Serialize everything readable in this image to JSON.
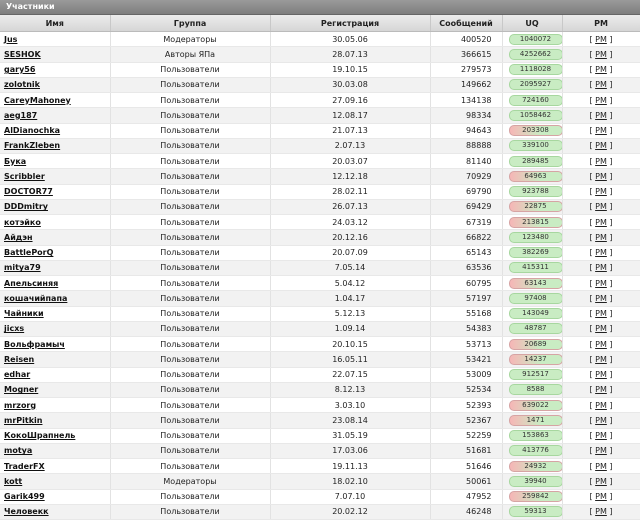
{
  "title": "Участники",
  "columns": {
    "name": "Имя",
    "group": "Группа",
    "reg": "Регистрация",
    "msgs": "Сообщений",
    "uq": "UQ",
    "pm": "PM"
  },
  "pm_label": "PM",
  "rows": [
    {
      "name": "Jus",
      "group": "Модераторы",
      "reg": "30.05.06",
      "msgs": "400520",
      "uq": "1040072",
      "sign": "pos"
    },
    {
      "name": "SESHOK",
      "group": "Авторы ЯПа",
      "reg": "28.07.13",
      "msgs": "366615",
      "uq": "4252662",
      "sign": "pos"
    },
    {
      "name": "gary56",
      "group": "Пользователи",
      "reg": "19.10.15",
      "msgs": "279573",
      "uq": "1118028",
      "sign": "pos"
    },
    {
      "name": "zolotnik",
      "group": "Пользователи",
      "reg": "30.03.08",
      "msgs": "149662",
      "uq": "2095927",
      "sign": "pos"
    },
    {
      "name": "CareyMahoney",
      "group": "Пользователи",
      "reg": "27.09.16",
      "msgs": "134138",
      "uq": "724160",
      "sign": "pos"
    },
    {
      "name": "aeg187",
      "group": "Пользователи",
      "reg": "12.08.17",
      "msgs": "98334",
      "uq": "1058462",
      "sign": "pos"
    },
    {
      "name": "AlDianochka",
      "group": "Пользователи",
      "reg": "21.07.13",
      "msgs": "94643",
      "uq": "203308",
      "sign": "neg"
    },
    {
      "name": "FrankZleben",
      "group": "Пользователи",
      "reg": "2.07.13",
      "msgs": "88888",
      "uq": "339100",
      "sign": "pos"
    },
    {
      "name": "Бука",
      "group": "Пользователи",
      "reg": "20.03.07",
      "msgs": "81140",
      "uq": "289485",
      "sign": "pos"
    },
    {
      "name": "Scribbler",
      "group": "Пользователи",
      "reg": "12.12.18",
      "msgs": "70929",
      "uq": "64963",
      "sign": "neg"
    },
    {
      "name": "DOCTOR77",
      "group": "Пользователи",
      "reg": "28.02.11",
      "msgs": "69790",
      "uq": "923788",
      "sign": "pos"
    },
    {
      "name": "DDDmitry",
      "group": "Пользователи",
      "reg": "26.07.13",
      "msgs": "69429",
      "uq": "22875",
      "sign": "neg"
    },
    {
      "name": "котэйко",
      "group": "Пользователи",
      "reg": "24.03.12",
      "msgs": "67319",
      "uq": "213815",
      "sign": "neg"
    },
    {
      "name": "Айдэн",
      "group": "Пользователи",
      "reg": "20.12.16",
      "msgs": "66822",
      "uq": "123480",
      "sign": "pos"
    },
    {
      "name": "BattlePorQ",
      "group": "Пользователи",
      "reg": "20.07.09",
      "msgs": "65143",
      "uq": "382269",
      "sign": "pos"
    },
    {
      "name": "mitya79",
      "group": "Пользователи",
      "reg": "7.05.14",
      "msgs": "63536",
      "uq": "415311",
      "sign": "pos"
    },
    {
      "name": "Апельсиняя",
      "group": "Пользователи",
      "reg": "5.04.12",
      "msgs": "60795",
      "uq": "63143",
      "sign": "neg"
    },
    {
      "name": "кошачийпапа",
      "group": "Пользователи",
      "reg": "1.04.17",
      "msgs": "57197",
      "uq": "97408",
      "sign": "pos"
    },
    {
      "name": "Чайники",
      "group": "Пользователи",
      "reg": "5.12.13",
      "msgs": "55168",
      "uq": "143049",
      "sign": "pos"
    },
    {
      "name": "jicxs",
      "group": "Пользователи",
      "reg": "1.09.14",
      "msgs": "54383",
      "uq": "48787",
      "sign": "pos"
    },
    {
      "name": "Вольфрамыч",
      "group": "Пользователи",
      "reg": "20.10.15",
      "msgs": "53713",
      "uq": "20689",
      "sign": "neg"
    },
    {
      "name": "Reisen",
      "group": "Пользователи",
      "reg": "16.05.11",
      "msgs": "53421",
      "uq": "14237",
      "sign": "neg"
    },
    {
      "name": "edhar",
      "group": "Пользователи",
      "reg": "22.07.15",
      "msgs": "53009",
      "uq": "912517",
      "sign": "pos"
    },
    {
      "name": "Mogner",
      "group": "Пользователи",
      "reg": "8.12.13",
      "msgs": "52534",
      "uq": "8588",
      "sign": "pos"
    },
    {
      "name": "mrzorg",
      "group": "Пользователи",
      "reg": "3.03.10",
      "msgs": "52393",
      "uq": "639022",
      "sign": "neg"
    },
    {
      "name": "mrPitkin",
      "group": "Пользователи",
      "reg": "23.08.14",
      "msgs": "52367",
      "uq": "1471",
      "sign": "neg"
    },
    {
      "name": "КокоШрапнель",
      "group": "Пользователи",
      "reg": "31.05.19",
      "msgs": "52259",
      "uq": "153863",
      "sign": "pos"
    },
    {
      "name": "motya",
      "group": "Пользователи",
      "reg": "17.03.06",
      "msgs": "51681",
      "uq": "413776",
      "sign": "pos"
    },
    {
      "name": "TraderFX",
      "group": "Пользователи",
      "reg": "19.11.13",
      "msgs": "51646",
      "uq": "24932",
      "sign": "neg"
    },
    {
      "name": "kott",
      "group": "Модераторы",
      "reg": "18.02.10",
      "msgs": "50061",
      "uq": "39940",
      "sign": "pos"
    },
    {
      "name": "Garik499",
      "group": "Пользователи",
      "reg": "7.07.10",
      "msgs": "47952",
      "uq": "259842",
      "sign": "neg"
    },
    {
      "name": "Человекк",
      "group": "Пользователи",
      "reg": "20.02.12",
      "msgs": "46248",
      "uq": "59313",
      "sign": "pos"
    }
  ]
}
